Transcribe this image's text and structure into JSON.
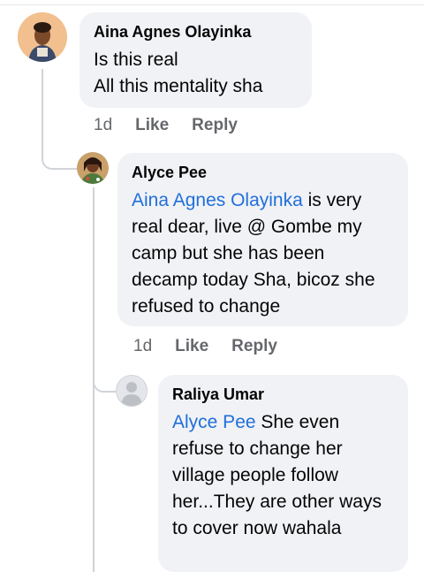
{
  "comments": [
    {
      "author": "Aina Agnes Olayinka",
      "lines": [
        "Is this real",
        "All this mentality sha"
      ],
      "time": "1d",
      "like_label": "Like",
      "reply_label": "Reply"
    },
    {
      "author": "Alyce Pee",
      "mention": "Aina Agnes Olayinka",
      "text_after_mention": " is very real dear, live @ Gombe my camp but she has been decamp today Sha, bicoz she refused to change",
      "time": "1d",
      "like_label": "Like",
      "reply_label": "Reply"
    },
    {
      "author": "Raliya Umar",
      "mention": "Alyce Pee",
      "text_after_mention": " She even refuse to change her village people follow her...They are other ways to cover now wahala"
    }
  ],
  "colors": {
    "bubble": "#f0f2f5",
    "mention": "#216fdb",
    "meta": "#65676b",
    "thread_line": "#d0d3d8"
  }
}
